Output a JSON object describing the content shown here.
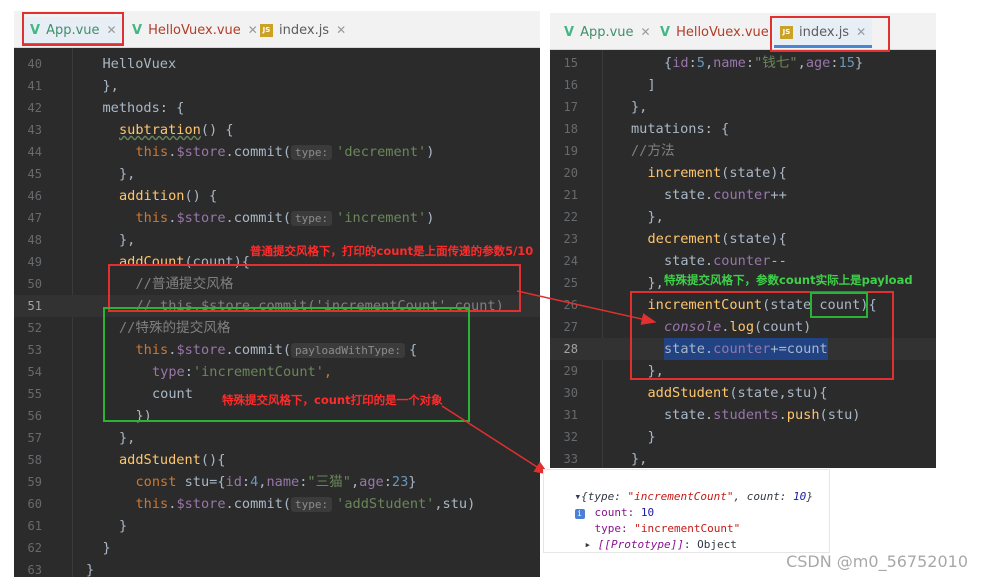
{
  "left_editor": {
    "tabs": [
      {
        "label": "App.vue",
        "icon": "vue-icon"
      },
      {
        "label": "HelloVuex.vue",
        "icon": "vue-icon"
      },
      {
        "label": "index.js",
        "icon": "js-file-icon"
      }
    ],
    "lines": [
      {
        "num": "40",
        "tokens": [
          {
            "c": "p",
            "t": "HelloVuex"
          }
        ]
      },
      {
        "num": "41",
        "tokens": [
          {
            "c": "p",
            "t": "},"
          }
        ]
      },
      {
        "num": "42",
        "tokens": [
          {
            "c": "p",
            "t": "methods: {"
          }
        ]
      },
      {
        "num": "43",
        "tokens": [
          {
            "c": "f",
            "t": "subtration",
            "w": 1
          },
          {
            "c": "p",
            "t": "() {"
          }
        ]
      },
      {
        "num": "44",
        "tokens": [
          {
            "c": "k",
            "t": "this"
          },
          {
            "c": "p",
            "t": "."
          },
          {
            "c": "pr",
            "t": "$store"
          },
          {
            "c": "p",
            "t": ".commit("
          },
          {
            "c": "hint",
            "t": "type:"
          },
          {
            "c": "s",
            "t": "'decrement'"
          },
          {
            "c": "p",
            "t": ")"
          }
        ]
      },
      {
        "num": "45",
        "tokens": [
          {
            "c": "p",
            "t": "},"
          }
        ]
      },
      {
        "num": "46",
        "tokens": [
          {
            "c": "f",
            "t": "addition"
          },
          {
            "c": "p",
            "t": "() {"
          }
        ]
      },
      {
        "num": "47",
        "tokens": [
          {
            "c": "k",
            "t": "this"
          },
          {
            "c": "p",
            "t": "."
          },
          {
            "c": "pr",
            "t": "$store"
          },
          {
            "c": "p",
            "t": ".commit("
          },
          {
            "c": "hint",
            "t": "type:"
          },
          {
            "c": "s",
            "t": "'increment'"
          },
          {
            "c": "p",
            "t": ")"
          }
        ]
      },
      {
        "num": "48",
        "tokens": [
          {
            "c": "p",
            "t": "},"
          }
        ]
      },
      {
        "num": "49",
        "tokens": [
          {
            "c": "f",
            "t": "addCount"
          },
          {
            "c": "p",
            "t": "(count){"
          }
        ]
      },
      {
        "num": "50",
        "tokens": [
          {
            "c": "c",
            "t": "//普通提交风格"
          }
        ]
      },
      {
        "num": "51",
        "tokens": [
          {
            "c": "c",
            "t": "// this.$store.commit('incrementCount',count)"
          }
        ]
      },
      {
        "num": "52",
        "tokens": [
          {
            "c": "c",
            "t": "//特殊的提交风格"
          }
        ]
      },
      {
        "num": "53",
        "tokens": [
          {
            "c": "k",
            "t": "this"
          },
          {
            "c": "p",
            "t": "."
          },
          {
            "c": "pr",
            "t": "$store"
          },
          {
            "c": "p",
            "t": ".commit("
          },
          {
            "c": "hint",
            "t": "payloadWithType:"
          },
          {
            "c": "p",
            "t": "{"
          }
        ]
      },
      {
        "num": "54",
        "tokens": [
          {
            "c": "pr",
            "t": "type"
          },
          {
            "c": "p",
            "t": ":"
          },
          {
            "c": "s",
            "t": "'incrementCount'"
          },
          {
            "c": "k",
            "t": ","
          }
        ]
      },
      {
        "num": "55",
        "tokens": [
          {
            "c": "p",
            "t": "count"
          }
        ]
      },
      {
        "num": "56",
        "tokens": [
          {
            "c": "p",
            "t": "})"
          }
        ]
      },
      {
        "num": "57",
        "tokens": [
          {
            "c": "p",
            "t": "},"
          }
        ]
      },
      {
        "num": "58",
        "tokens": [
          {
            "c": "f",
            "t": "addStudent"
          },
          {
            "c": "p",
            "t": "(){"
          }
        ]
      },
      {
        "num": "59",
        "tokens": [
          {
            "c": "k",
            "t": "const "
          },
          {
            "c": "p",
            "t": "stu={"
          },
          {
            "c": "pr",
            "t": "id"
          },
          {
            "c": "p",
            "t": ":"
          },
          {
            "c": "n",
            "t": "4"
          },
          {
            "c": "p",
            "t": ","
          },
          {
            "c": "pr",
            "t": "name"
          },
          {
            "c": "p",
            "t": ":"
          },
          {
            "c": "s",
            "t": "\"三猫\""
          },
          {
            "c": "p",
            "t": ","
          },
          {
            "c": "pr",
            "t": "age"
          },
          {
            "c": "p",
            "t": ":"
          },
          {
            "c": "n",
            "t": "23"
          },
          {
            "c": "p",
            "t": "}"
          }
        ]
      },
      {
        "num": "60",
        "tokens": [
          {
            "c": "k",
            "t": "this"
          },
          {
            "c": "p",
            "t": "."
          },
          {
            "c": "pr",
            "t": "$store"
          },
          {
            "c": "p",
            "t": ".commit("
          },
          {
            "c": "hint",
            "t": "type:"
          },
          {
            "c": "s",
            "t": "'addStudent'"
          },
          {
            "c": "p",
            "t": ",stu)"
          }
        ]
      },
      {
        "num": "61",
        "tokens": [
          {
            "c": "p",
            "t": "}"
          }
        ]
      },
      {
        "num": "62",
        "tokens": [
          {
            "c": "p",
            "t": "}"
          }
        ]
      },
      {
        "num": "63",
        "tokens": [
          {
            "c": "p",
            "t": "}"
          }
        ]
      }
    ]
  },
  "right_editor": {
    "tabs": [
      {
        "label": "App.vue",
        "icon": "vue-icon"
      },
      {
        "label": "HelloVuex.vue",
        "icon": "vue-icon"
      },
      {
        "label": "index.js",
        "icon": "js-file-icon"
      }
    ],
    "lines": [
      {
        "num": "15",
        "tokens": [
          {
            "c": "p",
            "t": "{"
          },
          {
            "c": "pr",
            "t": "id"
          },
          {
            "c": "p",
            "t": ":"
          },
          {
            "c": "n",
            "t": "5"
          },
          {
            "c": "p",
            "t": ","
          },
          {
            "c": "pr",
            "t": "name"
          },
          {
            "c": "p",
            "t": ":"
          },
          {
            "c": "s",
            "t": "\"钱七\""
          },
          {
            "c": "p",
            "t": ","
          },
          {
            "c": "pr",
            "t": "age"
          },
          {
            "c": "p",
            "t": ":"
          },
          {
            "c": "n",
            "t": "15"
          },
          {
            "c": "p",
            "t": "}"
          }
        ]
      },
      {
        "num": "16",
        "tokens": [
          {
            "c": "p",
            "t": "]"
          }
        ]
      },
      {
        "num": "17",
        "tokens": [
          {
            "c": "p",
            "t": "},"
          }
        ]
      },
      {
        "num": "18",
        "tokens": [
          {
            "c": "p",
            "t": "mutations: {"
          }
        ]
      },
      {
        "num": "19",
        "tokens": [
          {
            "c": "c",
            "t": "//方法"
          }
        ]
      },
      {
        "num": "20",
        "tokens": [
          {
            "c": "f",
            "t": "increment"
          },
          {
            "c": "p",
            "t": "(state){"
          }
        ]
      },
      {
        "num": "21",
        "tokens": [
          {
            "c": "p",
            "t": "state."
          },
          {
            "c": "pr",
            "t": "counter"
          },
          {
            "c": "p",
            "t": "++"
          }
        ]
      },
      {
        "num": "22",
        "tokens": [
          {
            "c": "p",
            "t": "},"
          }
        ]
      },
      {
        "num": "23",
        "tokens": [
          {
            "c": "f",
            "t": "decrement"
          },
          {
            "c": "p",
            "t": "(state){"
          }
        ]
      },
      {
        "num": "24",
        "tokens": [
          {
            "c": "p",
            "t": "state."
          },
          {
            "c": "pr",
            "t": "counter"
          },
          {
            "c": "p",
            "t": "--"
          }
        ]
      },
      {
        "num": "25",
        "tokens": [
          {
            "c": "p",
            "t": "},"
          }
        ]
      },
      {
        "num": "26",
        "tokens": [
          {
            "c": "f",
            "t": "incrementCount"
          },
          {
            "c": "p",
            "t": "(state "
          },
          {
            "c": "p",
            "t": "count"
          },
          {
            "c": "p",
            "t": "){"
          }
        ]
      },
      {
        "num": "27",
        "tokens": [
          {
            "c": "it",
            "t": "console"
          },
          {
            "c": "p",
            "t": "."
          },
          {
            "c": "f",
            "t": "log"
          },
          {
            "c": "p",
            "t": "(count)"
          }
        ]
      },
      {
        "num": "28",
        "tokens": [
          {
            "c": "p",
            "t": "state."
          },
          {
            "c": "pr",
            "t": "counter"
          },
          {
            "c": "p",
            "t": "+=count"
          }
        ]
      },
      {
        "num": "29",
        "tokens": [
          {
            "c": "p",
            "t": "},"
          }
        ]
      },
      {
        "num": "30",
        "tokens": [
          {
            "c": "f",
            "t": "addStudent"
          },
          {
            "c": "p",
            "t": "(state,stu){"
          }
        ]
      },
      {
        "num": "31",
        "tokens": [
          {
            "c": "p",
            "t": "state."
          },
          {
            "c": "pr",
            "t": "students"
          },
          {
            "c": "p",
            "t": "."
          },
          {
            "c": "f",
            "t": "push"
          },
          {
            "c": "p",
            "t": "(stu)"
          }
        ]
      },
      {
        "num": "32",
        "tokens": [
          {
            "c": "p",
            "t": "}"
          }
        ]
      },
      {
        "num": "33",
        "tokens": [
          {
            "c": "p",
            "t": "},"
          }
        ]
      }
    ]
  },
  "annotations": {
    "normal_commit": "普通提交风格下，打印的count是上面传递的参数5/10",
    "payload_note": "特殊提交风格下，参数count实际上是payload",
    "special_object": "特殊提交风格下，count打印的是一个对象"
  },
  "console_output": {
    "summary_prefix": "{type: ",
    "summary_type": "\"incrementCount\"",
    "summary_mid": ", count: ",
    "summary_count": "10",
    "summary_suffix": "}",
    "count_key": "count:",
    "count_value": "10",
    "type_key": "type:",
    "type_value": "\"incrementCount\"",
    "prototype_key": "[[Prototype]]",
    "prototype_value": "Object"
  },
  "watermark": "CSDN @m0_56752010",
  "colors": {
    "annotation_red": "#e03030",
    "annotation_green": "#2bb336",
    "editor_bg": "#2b2b2b"
  }
}
